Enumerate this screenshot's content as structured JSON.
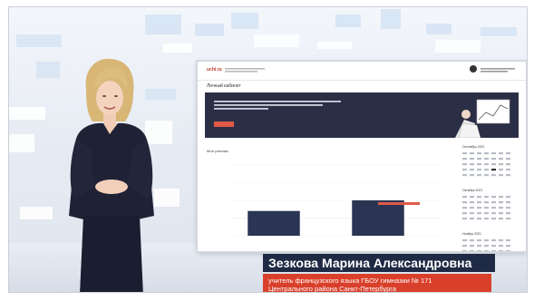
{
  "video": {
    "speaker_name": "Зезкова Марина Александровна",
    "speaker_title_line1": "учитель французского языка ГБОУ гимназии № 171",
    "speaker_title_line2": "Центрального района Санкт-Петербурга"
  },
  "screen": {
    "logo": "uchi.ru",
    "page_title": "Личный кабинет",
    "chart_section_title": "Мои ученики",
    "calendar_months": [
      "Сентябрь 2021",
      "Октябрь 2021",
      "Ноябрь 2021"
    ]
  },
  "colors": {
    "name_plate": "#1f2a44",
    "title_plate": "#d9402b",
    "banner": "#2b2f45",
    "chart_bar": "#2b3553",
    "accent": "#e05a47"
  },
  "chart_data": {
    "type": "bar",
    "categories": [
      "",
      ""
    ],
    "series": [
      {
        "values": [
          35,
          50
        ]
      }
    ]
  }
}
